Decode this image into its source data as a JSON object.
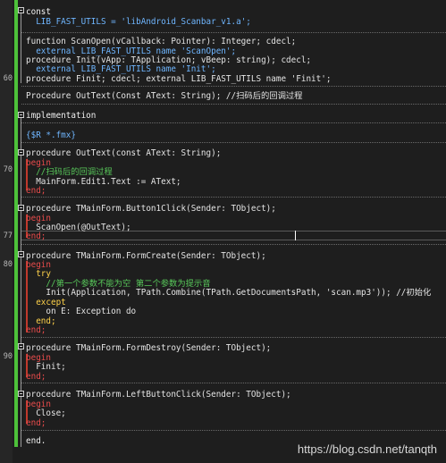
{
  "editor": {
    "line_numbers": {
      "l60": "60",
      "l70": "70",
      "l77": "77",
      "l80": "80",
      "l90": "90"
    },
    "lines": [
      "const",
      "  LIB_FAST_UTILS = 'libAndroid_Scanbar_v1.a';",
      "function ScanOpen(vCallback: Pointer): Integer; cdecl;",
      "  external LIB_FAST_UTILS name 'ScanOpen';",
      "procedure Init(vApp: TApplication; vBeep: string); cdecl;",
      "  external LIB_FAST_UTILS name 'Init';",
      "procedure Finit; cdecl; external LIB_FAST_UTILS name 'Finit';",
      "Procedure OutText(Const AText: String); //扫码后的回调过程",
      "implementation",
      "{$R *.fmx}",
      "procedure OutText(const AText: String);",
      "begin",
      "  //扫码后的回调过程",
      "  MainForm.Edit1.Text := AText;",
      "end;",
      "procedure TMainForm.Button1Click(Sender: TObject);",
      "begin",
      "  ScanOpen(@OutText);",
      "end;",
      "procedure TMainForm.FormCreate(Sender: TObject);",
      "begin",
      "  try",
      "    //第一个参数不能为空 第二个参数为提示音",
      "    Init(Application, TPath.Combine(TPath.GetDocumentsPath, 'scan.mp3')); //初始化",
      "  except",
      "    on E: Exception do",
      "  end;",
      "end;",
      "procedure TMainForm.FormDestroy(Sender: TObject);",
      "begin",
      "  Finit;",
      "end;",
      "procedure TMainForm.LeftButtonClick(Sender: TObject);",
      "begin",
      "  Close;",
      "end;",
      "end."
    ]
  },
  "watermark": "https://blog.csdn.net/tanqth"
}
